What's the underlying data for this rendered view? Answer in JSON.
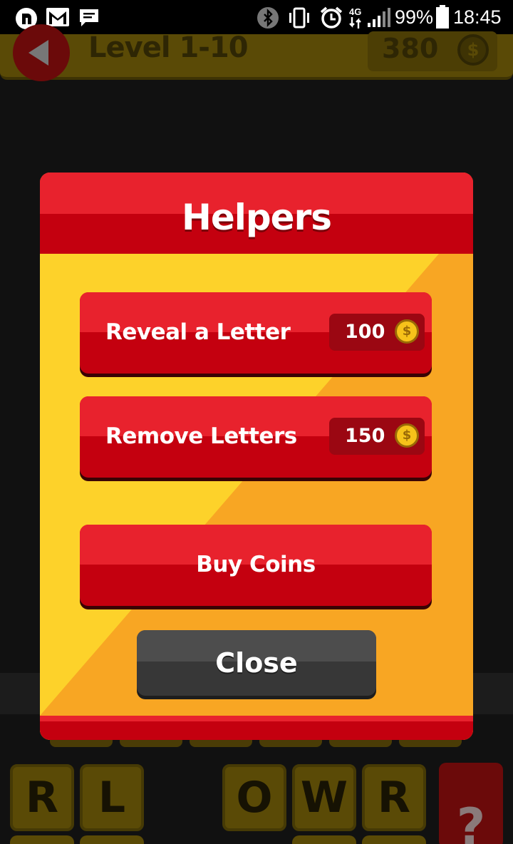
{
  "status_bar": {
    "battery": "99%",
    "time": "18:45",
    "network": "4G"
  },
  "game": {
    "level_title": "Level 1-10",
    "coins": "380",
    "coin_symbol": "$",
    "tiles": [
      "R",
      "L",
      "",
      "O",
      "W",
      "R"
    ],
    "hint_symbol": "?"
  },
  "dialog": {
    "title": "Helpers",
    "buttons": [
      {
        "label": "Reveal a Letter",
        "price": "100"
      },
      {
        "label": "Remove Letters",
        "price": "150"
      }
    ],
    "buy_coins_label": "Buy Coins",
    "close_label": "Close"
  },
  "colors": {
    "header_red": "#c4000f",
    "button_red": "#e8222d",
    "panel_yellow": "#fdd22a",
    "panel_orange": "#f8a623",
    "close_gray": "#373737"
  }
}
